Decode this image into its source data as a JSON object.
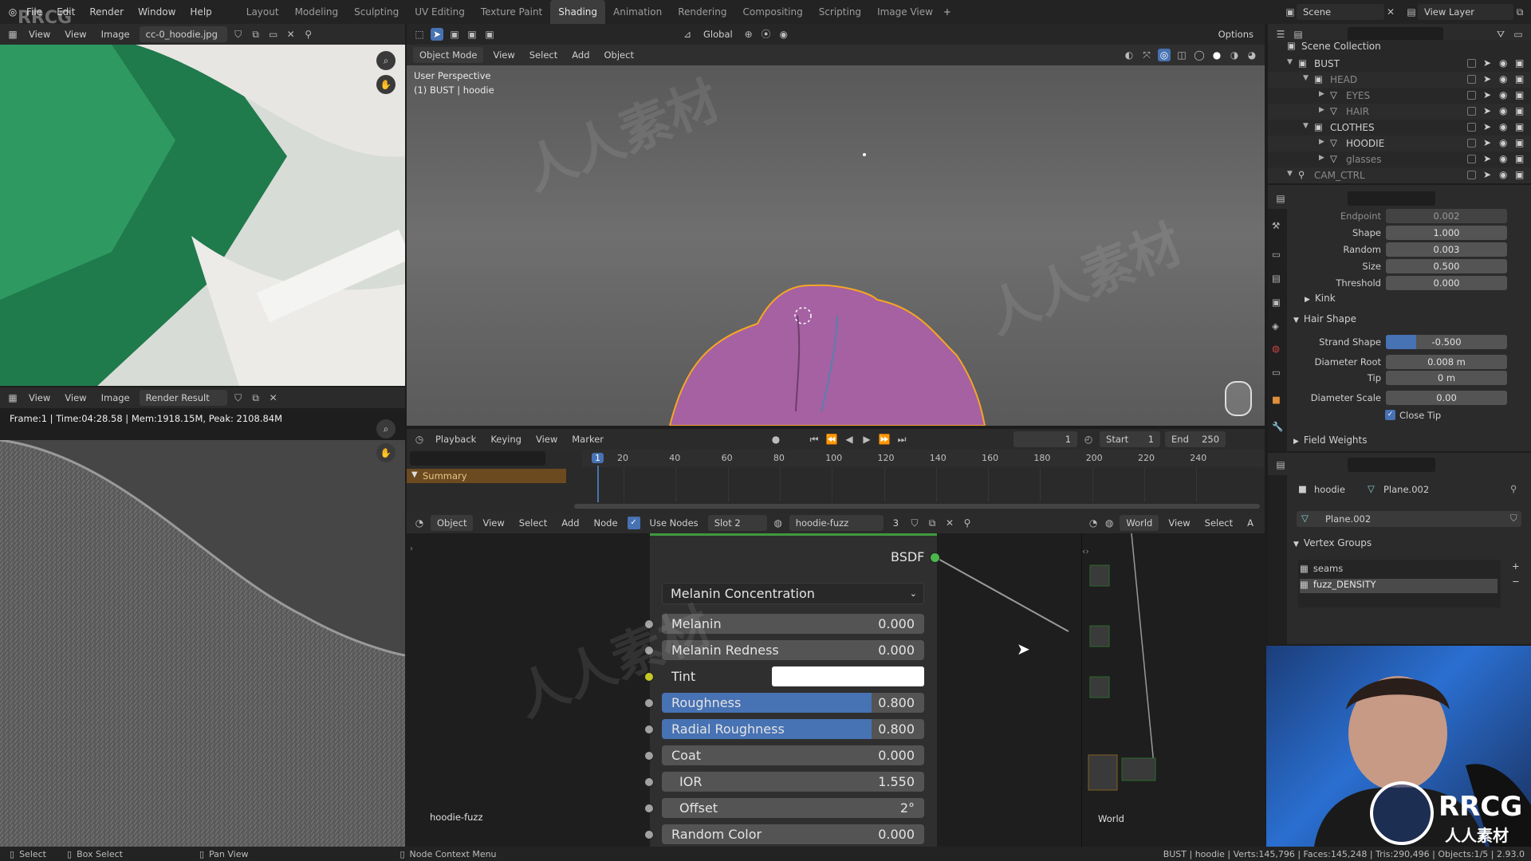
{
  "topbar": {
    "menus": [
      "File",
      "Edit",
      "Render",
      "Window",
      "Help"
    ],
    "workspaces": [
      "Layout",
      "Modeling",
      "Sculpting",
      "UV Editing",
      "Texture Paint",
      "Shading",
      "Animation",
      "Rendering",
      "Compositing",
      "Scripting",
      "Image View"
    ],
    "active_workspace": "Shading",
    "scene": "Scene",
    "view_layer": "View Layer"
  },
  "image_editor_top": {
    "menus": [
      "View",
      "View",
      "Image"
    ],
    "image_name": "cc-0_hoodie.jpg"
  },
  "image_editor_bottom": {
    "menus": [
      "View",
      "View",
      "Image"
    ],
    "image_name": "Render Result",
    "render_info": "Frame:1 | Time:04:28.58 | Mem:1918.15M, Peak: 2108.84M"
  },
  "viewport": {
    "mode": "Object Mode",
    "menus": [
      "View",
      "Select",
      "Add",
      "Object"
    ],
    "transform": "Global",
    "options": "Options",
    "overlay_line1": "User Perspective",
    "overlay_line2": "(1) BUST | hoodie"
  },
  "timeline": {
    "menus": [
      "Playback",
      "Keying",
      "View",
      "Marker"
    ],
    "current_frame": "1",
    "start_label": "Start",
    "start": "1",
    "end_label": "End",
    "end": "250",
    "ticks": [
      "1",
      "20",
      "40",
      "60",
      "80",
      "100",
      "120",
      "140",
      "160",
      "180",
      "200",
      "220",
      "240"
    ],
    "summary": "Summary"
  },
  "node_editor": {
    "object": "Object",
    "menus": [
      "View",
      "Select",
      "Add",
      "Node"
    ],
    "use_nodes": "Use Nodes",
    "slot": "Slot 2",
    "material": "hoodie-fuzz",
    "users": "3",
    "material_label": "hoodie-fuzz",
    "bsdf_label": "BSDF",
    "parametrization": "Melanin Concentration",
    "rows": [
      {
        "label": "Melanin",
        "value": "0.000",
        "fill": 0
      },
      {
        "label": "Melanin Redness",
        "value": "0.000",
        "fill": 0
      },
      {
        "label": "Tint",
        "value": "",
        "fill": 0
      },
      {
        "label": "Roughness",
        "value": "0.800",
        "fill": 0.8
      },
      {
        "label": "Radial Roughness",
        "value": "0.800",
        "fill": 0.8
      },
      {
        "label": "Coat",
        "value": "0.000",
        "fill": 0
      },
      {
        "label": "IOR",
        "value": "1.550",
        "fill": 0
      },
      {
        "label": "Offset",
        "value": "2°",
        "fill": 0
      },
      {
        "label": "Random Color",
        "value": "0.000",
        "fill": 0
      }
    ]
  },
  "world_editor": {
    "world": "World",
    "menus": [
      "View",
      "Select",
      "A"
    ],
    "world_label": "World"
  },
  "outliner": {
    "root": "Scene Collection",
    "items": [
      {
        "name": "BUST",
        "level": 1
      },
      {
        "name": "HEAD",
        "level": 2
      },
      {
        "name": "EYES",
        "level": 3
      },
      {
        "name": "HAIR",
        "level": 3
      },
      {
        "name": "CLOTHES",
        "level": 2
      },
      {
        "name": "HOODIE",
        "level": 3
      },
      {
        "name": "glasses",
        "level": 3
      },
      {
        "name": "CAM_CTRL",
        "level": 1
      }
    ]
  },
  "properties_top": {
    "rows": [
      {
        "label": "Endpoint",
        "value": "0.002"
      },
      {
        "label": "Shape",
        "value": "1.000"
      },
      {
        "label": "Random",
        "value": "0.003"
      },
      {
        "label": "Size",
        "value": "0.500"
      },
      {
        "label": "Threshold",
        "value": "0.000"
      }
    ],
    "kink": "Kink",
    "hair_shape": "Hair Shape",
    "shape_rows": [
      {
        "label": "Strand Shape",
        "value": "-0.500"
      },
      {
        "label": "Diameter Root",
        "value": "0.008 m"
      },
      {
        "label": "Tip",
        "value": "0 m"
      },
      {
        "label": "Diameter Scale",
        "value": "0.00"
      }
    ],
    "close_tip": "Close Tip",
    "field_weights": "Field Weights"
  },
  "properties_bottom": {
    "object": "hoodie",
    "mesh": "Plane.002",
    "mesh_field": "Plane.002",
    "vertex_groups": "Vertex Groups",
    "groups": [
      "seams",
      "fuzz_DENSITY"
    ]
  },
  "statusbar": {
    "select": "Select",
    "box_select": "Box Select",
    "pan_view": "Pan View",
    "context_menu": "Node Context Menu",
    "stats": "BUST | hoodie | Verts:145,796 | Faces:145,248 | Tris:290,496 | Objects:1/5 | 2.93.0"
  },
  "branding": {
    "logo": "RRCG",
    "watermark_cn": "人人素材",
    "logo_sub": "人人素材"
  },
  "colors": {
    "accent": "#4772b3",
    "selected": "#f5a623",
    "hoodie": "#a561a2"
  }
}
